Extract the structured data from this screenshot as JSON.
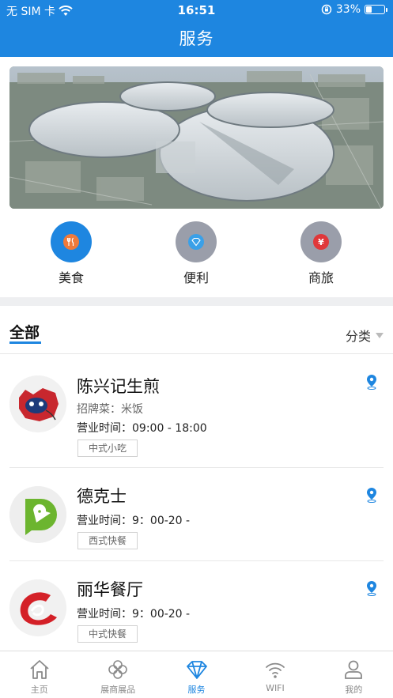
{
  "status_bar": {
    "carrier": "无 SIM 卡",
    "time": "16:51",
    "battery_percent": "33%",
    "battery_level": 0.33
  },
  "header": {
    "title": "服务"
  },
  "categories": [
    {
      "label": "美食",
      "icon": "fork-knife-icon",
      "color": "#1e86e0",
      "inner_color": "#f07a3a"
    },
    {
      "label": "便利",
      "icon": "diamond-icon",
      "color": "#9a9eaa",
      "inner_color": "#3aa0e8"
    },
    {
      "label": "商旅",
      "icon": "yen-icon",
      "color": "#9a9eaa",
      "inner_color": "#e0383a"
    }
  ],
  "filter": {
    "all_label": "全部",
    "classify_label": "分类"
  },
  "restaurants": [
    {
      "name": "陈兴记生煎",
      "signature": "招牌菜：米饭",
      "hours": "营业时间：09:00 - 18:00",
      "tag": "中式小吃"
    },
    {
      "name": "德克士",
      "hours": "营业时间：9：00-20 -",
      "tag": "西式快餐"
    },
    {
      "name": "丽华餐厅",
      "hours": "营业时间：9：00-20 -",
      "tag": "中式快餐"
    }
  ],
  "tabbar": [
    {
      "label": "主页",
      "icon": "home-icon"
    },
    {
      "label": "展商展品",
      "icon": "flower-icon"
    },
    {
      "label": "服务",
      "icon": "diamond-icon",
      "active": true
    },
    {
      "label": "WIFI",
      "icon": "wifi-icon"
    },
    {
      "label": "我的",
      "icon": "user-icon"
    }
  ],
  "colors": {
    "accent": "#1e86e0",
    "inactive": "#8a8a8a"
  }
}
